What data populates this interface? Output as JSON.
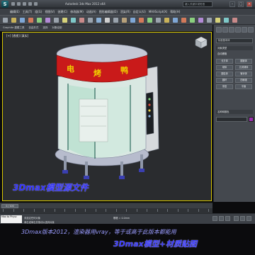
{
  "titlebar": {
    "app_title": "Autodesk 3ds Max 2012 x64",
    "search_placeholder": "键入关键字或短语"
  },
  "menu": [
    "编辑(E)",
    "工具(T)",
    "组(G)",
    "视图(V)",
    "创建(C)",
    "修改器(M)",
    "动画(A)",
    "图形编辑器(D)",
    "渲染(R)",
    "自定义(U)",
    "MAXScript(X)",
    "帮助(H)"
  ],
  "ribbon_tabs": [
    "Graphite 建模工具",
    "自由形式",
    "选择",
    "对象绘制"
  ],
  "viewport": {
    "label": "[+] [透视] [真实]",
    "caption": "3Dmax模型源文件",
    "sign_text": "电 烤 鸭"
  },
  "command_panel": {
    "dropdown": "标准基本体",
    "section_object_type": "对象类型",
    "auto_grid": "自动栅格",
    "buttons": [
      "长方体",
      "圆锥体",
      "球体",
      "几何球体",
      "圆柱体",
      "管状体",
      "圆环",
      "四棱锥",
      "茶壶",
      "平面"
    ],
    "section_name_color": "名称和颜色",
    "object_color": "#9b2fb0"
  },
  "timeline": {
    "slider_label": "0 / 100"
  },
  "status": {
    "listener": "Max to Physc",
    "selection": "未选定任何对象",
    "prompt": "单击或单击并拖动以选择对象",
    "grid": "栅格 = 0.0mm"
  },
  "banner": {
    "line1": "3Dmax版本2012，渲染器用vray，等于或高于此版本都能用",
    "line2": "3Dmax模型+材质贴图"
  },
  "colors": {
    "viewport_border": "#d8c800",
    "sign_red": "#c91a1a",
    "sign_text": "#f0d000",
    "caption_blue": "#2f2fff"
  }
}
